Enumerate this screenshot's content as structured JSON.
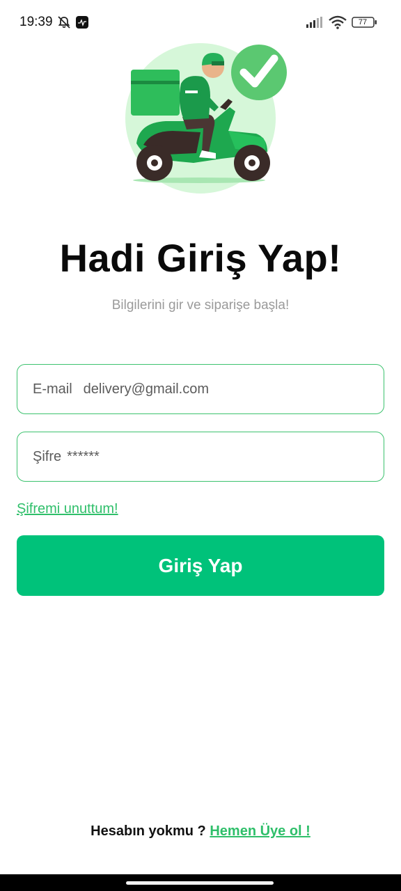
{
  "status_bar": {
    "time": "19:39",
    "battery": "77",
    "icons": [
      "bell-off-icon",
      "app-icon",
      "signal-icon",
      "wifi-icon",
      "battery-icon"
    ]
  },
  "hero": {
    "icon": "delivery-scooter-illustration",
    "check_icon": "check-circle-icon"
  },
  "login": {
    "title": "Hadi Giriş Yap!",
    "subtitle": "Bilgilerini gir ve siparişe başla!",
    "email_label": "E-mail",
    "email_value": "delivery@gmail.com",
    "password_label": "Şifre",
    "password_value": "******",
    "forgot_password": "Şifremi unuttum!",
    "login_button": "Giriş Yap"
  },
  "signup": {
    "prompt": "Hesabın yokmu ?",
    "link": "Hemen Üye ol !"
  },
  "colors": {
    "accent": "#00c27a",
    "field_border": "#3cc26e",
    "link": "#2fbf6a",
    "subtitle": "#9a9a9a"
  }
}
